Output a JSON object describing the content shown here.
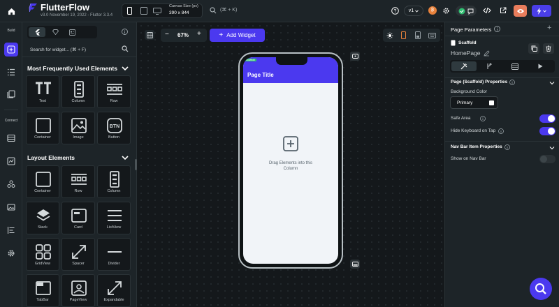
{
  "app": {
    "name": "FlutterFlow",
    "version": "v3.0 November 19, 2022 - Flutter 3.3.4"
  },
  "topbar": {
    "canvas_size_label": "Canvas Size (px)",
    "canvas_size_value": "390 x 844",
    "search_shortcut": "(⌘ + K)",
    "version_badge": "v1",
    "accent_color": "#4b39ef",
    "preview_color": "#e97d5c"
  },
  "rail": {
    "build_label": "Build",
    "connect_label": "Connect"
  },
  "widget_panel": {
    "search_placeholder": "Search for widget... (⌘ + F)",
    "sections": [
      {
        "title": "Most Frequently Used Elements",
        "items": [
          {
            "label": "Text",
            "icon": "text-icon"
          },
          {
            "label": "Column",
            "icon": "column-icon"
          },
          {
            "label": "Row",
            "icon": "row-icon"
          },
          {
            "label": "Container",
            "icon": "container-icon"
          },
          {
            "label": "Image",
            "icon": "image-icon"
          },
          {
            "label": "Button",
            "icon": "button-icon"
          }
        ]
      },
      {
        "title": "Layout Elements",
        "items": [
          {
            "label": "Container",
            "icon": "container-icon"
          },
          {
            "label": "Row",
            "icon": "row-icon"
          },
          {
            "label": "Column",
            "icon": "column-icon"
          },
          {
            "label": "Stack",
            "icon": "stack-icon"
          },
          {
            "label": "Card",
            "icon": "card-icon"
          },
          {
            "label": "ListView",
            "icon": "listview-icon"
          },
          {
            "label": "GridView",
            "icon": "gridview-icon"
          },
          {
            "label": "Spacer",
            "icon": "spacer-icon"
          },
          {
            "label": "Divider",
            "icon": "divider-icon"
          },
          {
            "label": "TabBar",
            "icon": "tabbar-icon"
          },
          {
            "label": "PageView",
            "icon": "pageview-icon"
          },
          {
            "label": "Expandable",
            "icon": "expandable-icon"
          }
        ]
      }
    ]
  },
  "canvas": {
    "zoom": "67%",
    "add_widget_label": "Add Widget",
    "page_title": "Page Title",
    "scaffold_tag": "Scaffold",
    "drop_hint": "Drag Elements into this Column"
  },
  "properties": {
    "title": "Page Parameters",
    "widget_type": "Scaffold",
    "page_name": "HomePage",
    "scaffold_section": "Page (Scaffold) Properties",
    "background_color_label": "Background Color",
    "background_color_value": "Primary",
    "safe_area_label": "Safe Area",
    "safe_area_on": true,
    "hide_keyboard_label": "Hide Keyboard on Tap",
    "hide_keyboard_on": true,
    "navbar_section": "Nav Bar Item Properties",
    "show_navbar_label": "Show on Nav Bar",
    "show_navbar_on": false
  }
}
